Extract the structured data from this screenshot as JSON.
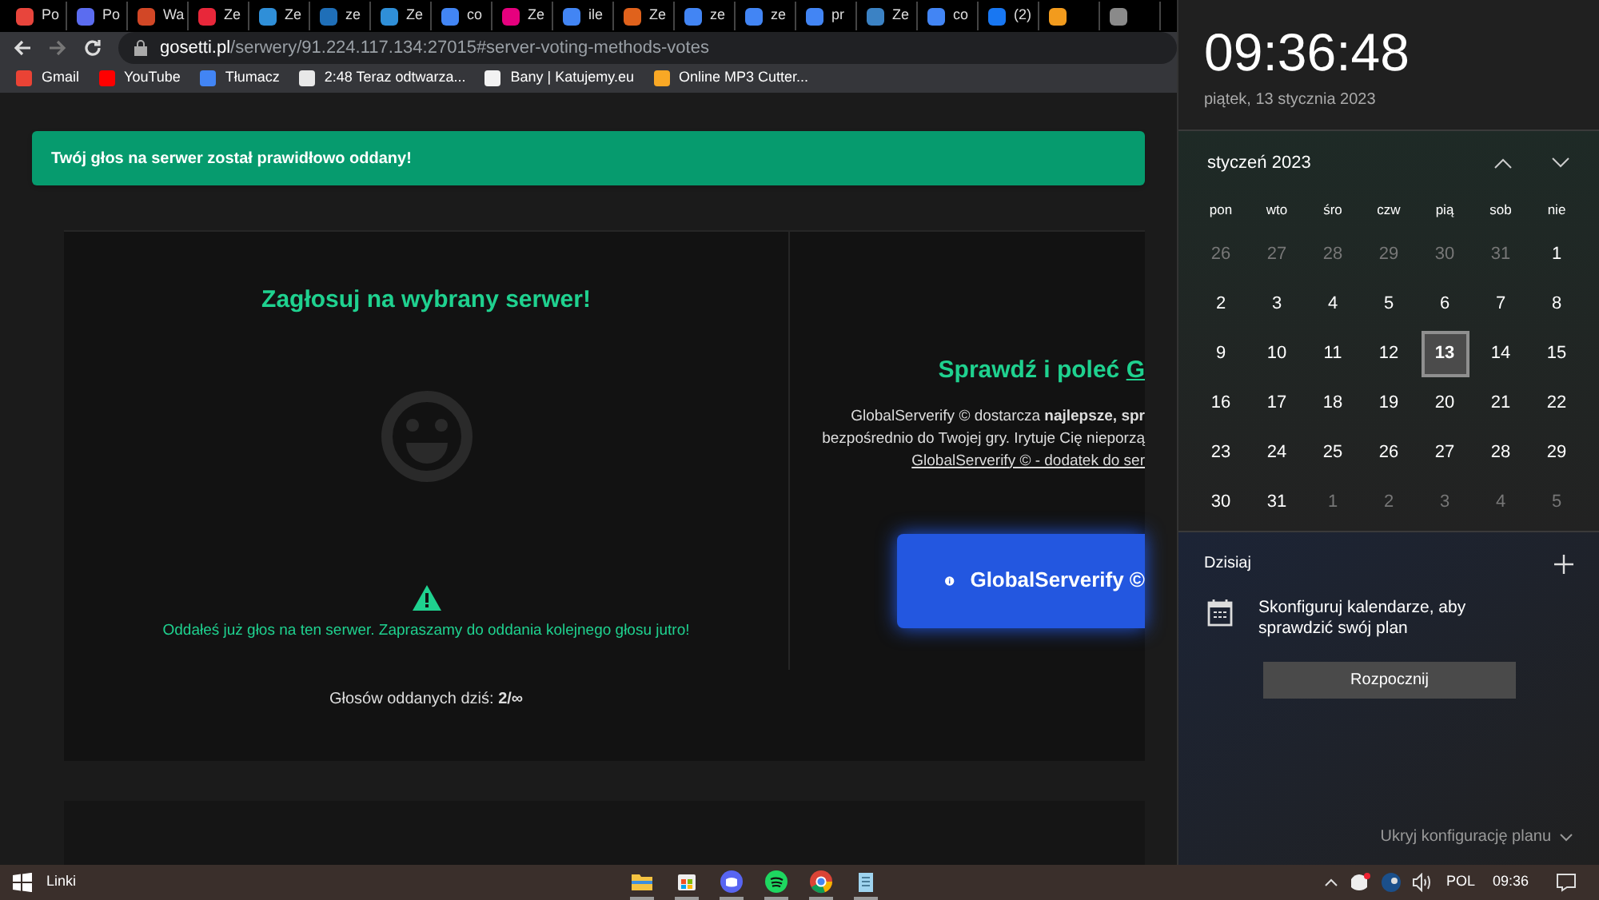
{
  "browser": {
    "tabs": [
      {
        "label": "Po",
        "color": "#e8453c"
      },
      {
        "label": "Po",
        "color": "#5b6cf0"
      },
      {
        "label": "Wa",
        "color": "#d24726"
      },
      {
        "label": "Ze",
        "color": "#e8273a"
      },
      {
        "label": "Ze",
        "color": "#2f8fd8"
      },
      {
        "label": "ze",
        "color": "#1f6fb8"
      },
      {
        "label": "Ze",
        "color": "#2f8fd8"
      },
      {
        "label": "co",
        "color": "#4285f4"
      },
      {
        "label": "Ze",
        "color": "#e6007e"
      },
      {
        "label": "ile",
        "color": "#4285f4"
      },
      {
        "label": "Ze",
        "color": "#e0621c"
      },
      {
        "label": "ze",
        "color": "#4285f4"
      },
      {
        "label": "ze",
        "color": "#4285f4"
      },
      {
        "label": "pr",
        "color": "#4285f4"
      },
      {
        "label": "Ze",
        "color": "#3b82c4"
      },
      {
        "label": "co",
        "color": "#4285f4"
      },
      {
        "label": "(2)",
        "color": "#1877f2"
      },
      {
        "color": "#f29b1d"
      },
      {
        "color": "#8a8a8a"
      }
    ],
    "address": {
      "host": "gosetti.pl",
      "path": "/serwery/91.224.117.134:27015#server-voting-methods-votes"
    },
    "bookmarks": [
      {
        "label": "Gmail",
        "color": "#ea4335"
      },
      {
        "label": "YouTube",
        "color": "#ff0000"
      },
      {
        "label": "Tłumacz",
        "color": "#4285f4"
      },
      {
        "label": "2:48 Teraz odtwarza...",
        "color": "#e8e8e8"
      },
      {
        "label": "Bany | Katujemy.eu",
        "color": "#f2f2f2"
      },
      {
        "label": "Online MP3 Cutter...",
        "color": "#f9a825"
      }
    ]
  },
  "page": {
    "alert": "Twój głos na serwer został prawidłowo oddany!",
    "left": {
      "title": "Zagłosuj na wybrany serwer!",
      "warning": "Oddałeś już głos na ten serwer. Zapraszamy do oddania kolejnego głosu jutro!",
      "votes": "Głosów oddanych dziś: **2/∞**"
    },
    "right": {
      "title": "Sprawdź i poleć ",
      "title_link": "G",
      "description": [
        "GlobalServerify © dostarcza **najlepsze, spr**",
        "bezpośrednio do Twojej gry. Irytuje Cię nieporzą"
      ],
      "link": "GlobalServerify © - dodatek do ser",
      "button": "GlobalServerify ©"
    }
  },
  "clock_flyout": {
    "time": "09:36:48",
    "date": "piątek, 13 stycznia 2023",
    "calendar": {
      "month": "styczeń 2023",
      "weekdays": [
        "pon",
        "wto",
        "śro",
        "czw",
        "pią",
        "sob",
        "nie"
      ],
      "days": [
        {
          "label": "26",
          "in_month": false,
          "selected": false
        },
        {
          "label": "27",
          "in_month": false,
          "selected": false
        },
        {
          "label": "28",
          "in_month": false,
          "selected": false
        },
        {
          "label": "29",
          "in_month": false,
          "selected": false
        },
        {
          "label": "30",
          "in_month": false,
          "selected": false
        },
        {
          "label": "31",
          "in_month": false,
          "selected": false
        },
        {
          "label": "1",
          "in_month": true,
          "selected": false
        },
        {
          "label": "2",
          "in_month": true,
          "selected": false
        },
        {
          "label": "3",
          "in_month": true,
          "selected": false
        },
        {
          "label": "4",
          "in_month": true,
          "selected": false
        },
        {
          "label": "5",
          "in_month": true,
          "selected": false
        },
        {
          "label": "6",
          "in_month": true,
          "selected": false
        },
        {
          "label": "7",
          "in_month": true,
          "selected": false
        },
        {
          "label": "8",
          "in_month": true,
          "selected": false
        },
        {
          "label": "9",
          "in_month": true,
          "selected": false
        },
        {
          "label": "10",
          "in_month": true,
          "selected": false
        },
        {
          "label": "11",
          "in_month": true,
          "selected": false
        },
        {
          "label": "12",
          "in_month": true,
          "selected": false
        },
        {
          "label": "13",
          "in_month": true,
          "selected": true
        },
        {
          "label": "14",
          "in_month": true,
          "selected": false
        },
        {
          "label": "15",
          "in_month": true,
          "selected": false
        },
        {
          "label": "16",
          "in_month": true,
          "selected": false
        },
        {
          "label": "17",
          "in_month": true,
          "selected": false
        },
        {
          "label": "18",
          "in_month": true,
          "selected": false
        },
        {
          "label": "19",
          "in_month": true,
          "selected": false
        },
        {
          "label": "20",
          "in_month": true,
          "selected": false
        },
        {
          "label": "21",
          "in_month": true,
          "selected": false
        },
        {
          "label": "22",
          "in_month": true,
          "selected": false
        },
        {
          "label": "23",
          "in_month": true,
          "selected": false
        },
        {
          "label": "24",
          "in_month": true,
          "selected": false
        },
        {
          "label": "25",
          "in_month": true,
          "selected": false
        },
        {
          "label": "26",
          "in_month": true,
          "selected": false
        },
        {
          "label": "27",
          "in_month": true,
          "selected": false
        },
        {
          "label": "28",
          "in_month": true,
          "selected": false
        },
        {
          "label": "29",
          "in_month": true,
          "selected": false
        },
        {
          "label": "30",
          "in_month": true,
          "selected": false
        },
        {
          "label": "31",
          "in_month": true,
          "selected": false
        },
        {
          "label": "1",
          "in_month": false,
          "selected": false
        },
        {
          "label": "2",
          "in_month": false,
          "selected": false
        },
        {
          "label": "3",
          "in_month": false,
          "selected": false
        },
        {
          "label": "4",
          "in_month": false,
          "selected": false
        },
        {
          "label": "5",
          "in_month": false,
          "selected": false
        }
      ]
    },
    "agenda": {
      "heading": "Dzisiaj",
      "message": "Skonfiguruj kalendarze, aby sprawdzić swój plan",
      "button": "Rozpocznij",
      "toggle": "Ukryj konfigurację planu"
    }
  },
  "taskbar": {
    "links": "Linki",
    "apps": [
      {
        "kind": "folder"
      },
      {
        "kind": "store"
      },
      {
        "kind": "discord"
      },
      {
        "kind": "spotify"
      },
      {
        "kind": "chrome"
      },
      {
        "kind": "notepad"
      }
    ],
    "tray": {
      "language": "POL",
      "time": "09:36"
    }
  }
}
